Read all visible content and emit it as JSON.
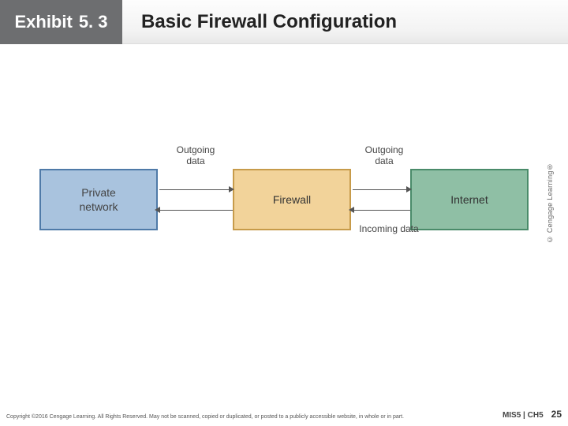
{
  "header": {
    "exhibit_label": "Exhibit",
    "exhibit_number": "5. 3",
    "title": "Basic Firewall Configuration"
  },
  "diagram": {
    "boxes": {
      "private": "Private\nnetwork",
      "firewall": "Firewall",
      "internet": "Internet"
    },
    "labels": {
      "outgoing": "Outgoing\ndata",
      "incoming": "Incoming data"
    },
    "credit": "© Cengage Learning®"
  },
  "footer": {
    "copyright": "Copyright ©2016 Cengage Learning. All Rights Reserved. May not be scanned, copied or duplicated, or posted to a publicly accessible website, in whole or in part.",
    "book": "MIS5 | CH5",
    "page": "25"
  }
}
